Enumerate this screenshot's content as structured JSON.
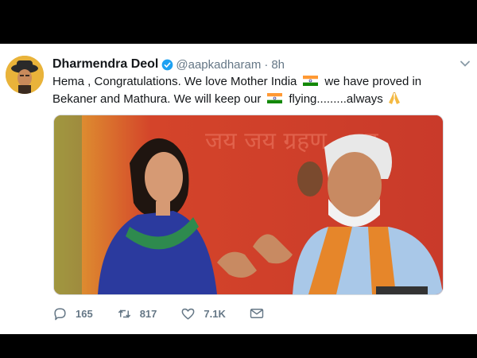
{
  "tweet": {
    "display_name": "Dharmendra Deol",
    "handle": "@aapkadharam",
    "separator": "·",
    "time": "8h",
    "text_segment_1": "Hema , Congratulations. We love  Mother India",
    "text_segment_2": "we have proved in Bekaner and Mathura. We will keep our",
    "text_segment_3": "flying.........always",
    "avatar_icon": "avatar",
    "verified_icon": "verified-badge-icon",
    "menu_icon": "chevron-down-icon",
    "emoji_icons": [
      "indian-flag-icon",
      "indian-flag-icon",
      "folded-hands-icon"
    ],
    "image_text": "जय जय ग्रहण ... गु"
  },
  "actions": {
    "reply_count": "165",
    "retweet_count": "817",
    "like_count": "7.1K",
    "icons": [
      "reply-icon",
      "retweet-icon",
      "like-icon",
      "direct-message-icon"
    ]
  },
  "colors": {
    "verified_blue": "#1da1f2",
    "text": "#14171a",
    "secondary_text": "#657786",
    "flag_saffron": "#ff9933",
    "flag_green": "#138808",
    "flag_chakra": "#000080"
  }
}
